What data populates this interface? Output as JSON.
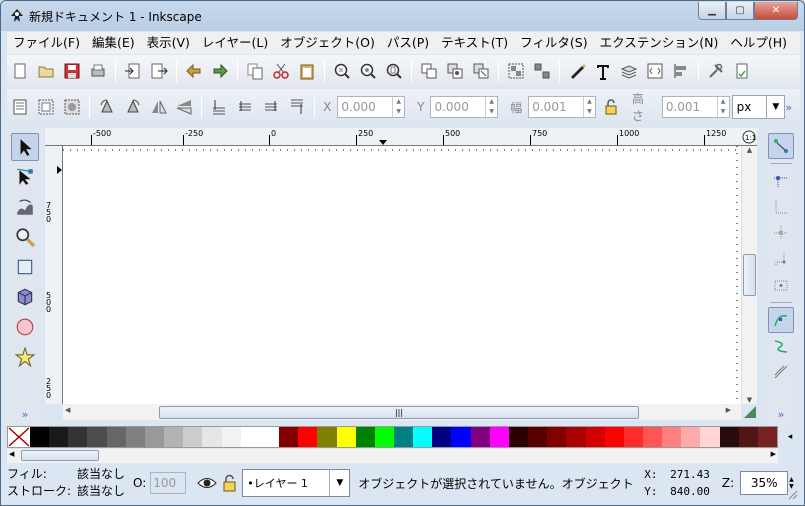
{
  "window": {
    "title": "新規ドキュメント 1 - Inkscape"
  },
  "menu": [
    "ファイル(F)",
    "編集(E)",
    "表示(V)",
    "レイヤー(L)",
    "オブジェクト(O)",
    "パス(P)",
    "テキスト(T)",
    "フィルタ(S)",
    "エクステンション(N)",
    "ヘルプ(H)"
  ],
  "toolbar": {
    "commands": [
      "new-doc-icon",
      "open-icon",
      "save-icon",
      "print-icon",
      "|",
      "import-icon",
      "export-icon",
      "|",
      "undo-icon",
      "redo-icon",
      "|",
      "copy-icon",
      "cut-icon",
      "paste-icon",
      "|",
      "zoom-selection-icon",
      "zoom-drawing-icon",
      "zoom-page-icon",
      "|",
      "duplicate-icon",
      "clone-icon",
      "unlink-clone-icon",
      "|",
      "group-icon",
      "ungroup-icon",
      "|",
      "fill-stroke-icon",
      "text-icon",
      "layers-icon",
      "xml-editor-icon",
      "align-icon",
      "|",
      "preferences-icon",
      "document-properties-icon"
    ]
  },
  "select_toolbar": {
    "x_label": "X",
    "x_value": "0.000",
    "y_label": "Y",
    "y_value": "0.000",
    "w_label": "幅",
    "w_value": "0.001",
    "h_label": "高さ",
    "h_value": "0.001",
    "unit": "px",
    "more": "»"
  },
  "ruler": {
    "h_ticks": [
      "-500",
      "-250",
      "0",
      "250",
      "500",
      "750",
      "1000",
      "1250"
    ],
    "v_ticks": [
      "750",
      "500",
      "250"
    ]
  },
  "tools": [
    "selector-tool-icon",
    "node-tool-icon",
    "tweak-tool-icon",
    "zoom-tool-icon",
    "rect-tool-icon",
    "box3d-tool-icon",
    "ellipse-tool-icon",
    "star-tool-icon"
  ],
  "tools_more": "»",
  "snap_more": "»",
  "palette": {
    "colors": [
      "#000000",
      "#1a1a1a",
      "#333333",
      "#4d4d4d",
      "#666666",
      "#808080",
      "#999999",
      "#b3b3b3",
      "#cccccc",
      "#e6e6e6",
      "#f2f2f2",
      "#ffffff",
      "#ffffff",
      "#800000",
      "#ff0000",
      "#808000",
      "#ffff00",
      "#008000",
      "#00ff00",
      "#008080",
      "#00ffff",
      "#000080",
      "#0000ff",
      "#800080",
      "#ff00ff",
      "#2b0000",
      "#550000",
      "#800000",
      "#aa0000",
      "#d40000",
      "#ff0000",
      "#ff2a2a",
      "#ff5555",
      "#ff8080",
      "#ffaaaa",
      "#ffd5d5",
      "#280b0b",
      "#501616",
      "#782121"
    ]
  },
  "status": {
    "fill_label": "フィル:",
    "fill_value": "該当なし",
    "stroke_label": "ストローク:",
    "stroke_value": "該当なし",
    "opacity_label": "O:",
    "opacity_value": "100",
    "layer": "•レイヤー 1",
    "message": "オブジェクトが選択されていません。オブジェクト",
    "x_label": "X:",
    "x_value": "271.43",
    "y_label": "Y:",
    "y_value": "840.00",
    "zoom_label": "Z:",
    "zoom_value": "35%"
  }
}
